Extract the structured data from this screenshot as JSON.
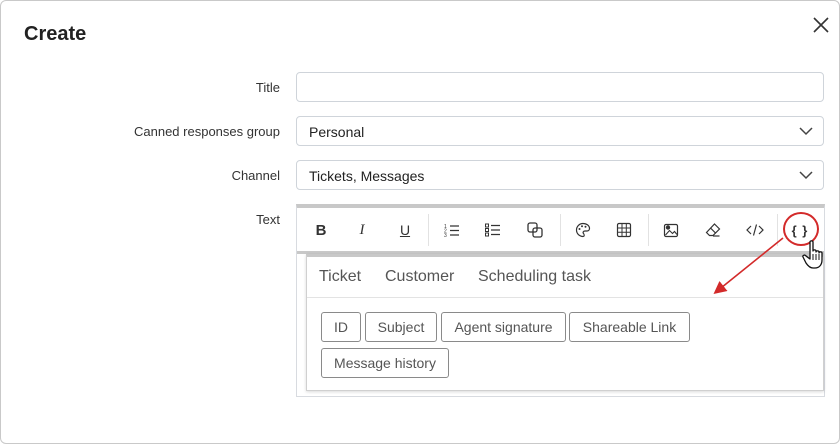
{
  "dialog": {
    "title": "Create",
    "close_icon": "close-icon"
  },
  "form": {
    "title_label": "Title",
    "title_value": "",
    "group_label": "Canned responses group",
    "group_value": "Personal",
    "channel_label": "Channel",
    "channel_value": "Tickets, Messages",
    "text_label": "Text"
  },
  "toolbar": {
    "buttons": [
      "bold-icon",
      "italic-icon",
      "underline-icon",
      "ordered-list-icon",
      "unordered-list-icon",
      "link-icon",
      "palette-icon",
      "table-icon",
      "image-icon",
      "eraser-icon",
      "code-icon",
      "variables-icon"
    ],
    "bold_glyph": "B",
    "italic_glyph": "I",
    "underline_glyph": "U",
    "variables_glyph": "{ }"
  },
  "variables": {
    "tabs": [
      "Ticket",
      "Customer",
      "Scheduling task"
    ],
    "chips": [
      "ID",
      "Subject",
      "Agent signature",
      "Shareable Link",
      "Message history"
    ]
  },
  "colors": {
    "annotation": "#d32a2a"
  }
}
